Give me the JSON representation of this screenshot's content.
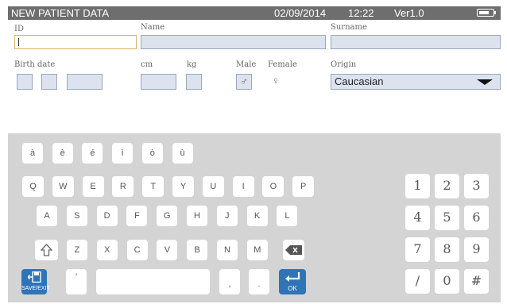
{
  "header": {
    "title": "NEW PATIENT DATA",
    "date": "02/09/2014",
    "time": "12:22",
    "version": "Ver1.0",
    "battery_level": 0.6
  },
  "form": {
    "id": {
      "label": "ID",
      "value": ""
    },
    "name": {
      "label": "Name",
      "value": ""
    },
    "surname": {
      "label": "Surname",
      "value": ""
    },
    "birth_date": {
      "label": "Birth date"
    },
    "height": {
      "label": "cm"
    },
    "weight": {
      "label": "kg"
    },
    "male": {
      "label": "Male",
      "symbol": "♂"
    },
    "female": {
      "label": "Female",
      "symbol": "♀"
    },
    "origin": {
      "label": "Origin",
      "value": "Caucasian"
    }
  },
  "keyboard": {
    "accent_row": [
      "à",
      "è",
      "é",
      "ì",
      "ò",
      "ù"
    ],
    "row1": [
      "Q",
      "W",
      "E",
      "R",
      "T",
      "Y",
      "U",
      "I",
      "O",
      "P"
    ],
    "row2": [
      "A",
      "S",
      "D",
      "F",
      "G",
      "H",
      "J",
      "K",
      "L"
    ],
    "row3": [
      "Z",
      "X",
      "C",
      "V",
      "B",
      "N",
      "M"
    ],
    "apostrophe": "'",
    "comma": ",",
    "period": ".",
    "save_label": "SAVE/EXIT",
    "ok_label": "OK",
    "accent_color": "#2f74b7"
  },
  "numpad": {
    "row1": [
      "1",
      "2",
      "3"
    ],
    "row2": [
      "4",
      "5",
      "6"
    ],
    "row3": [
      "7",
      "8",
      "9"
    ],
    "row4": [
      "/",
      "0",
      "#"
    ]
  }
}
